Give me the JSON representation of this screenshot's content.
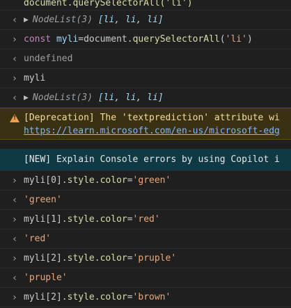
{
  "rows": [
    {
      "kind": "partial",
      "text": "document.querySelectorAll('li')"
    },
    {
      "kind": "nodelist",
      "prefix": "NodeList(3)",
      "items": "[li, li, li]"
    },
    {
      "kind": "input",
      "keyword": "const",
      "var": "myli",
      "rest1": "=document.",
      "fn": "querySelectorAll",
      "open": "(",
      "str": "'li'",
      "close": ")"
    },
    {
      "kind": "output",
      "text": "undefined"
    },
    {
      "kind": "input-plain",
      "text": "myli"
    },
    {
      "kind": "nodelist",
      "prefix": "NodeList(3)",
      "items": "[li, li, li]"
    }
  ],
  "warning": {
    "line1": "[Deprecation] The 'textprediction' attribute wi",
    "line2": "https://learn.microsoft.com/en-us/microsoft-edg"
  },
  "info": {
    "text": "[NEW] Explain Console errors by using Copilot i"
  },
  "commands": [
    {
      "obj": "myli[0].",
      "prop": "style.color",
      "eq": "=",
      "val": "'green'",
      "out": "'green'"
    },
    {
      "obj": "myli[1].",
      "prop": "style.color",
      "eq": "=",
      "val": "'red'",
      "out": "'red'"
    },
    {
      "obj": "myli[2].",
      "prop": "style.color",
      "eq": "=",
      "val": "'pruple'",
      "out": "'pruple'"
    },
    {
      "obj": "myli[2].",
      "prop": "style.color",
      "eq": "=",
      "val": "'brown'",
      "out": ""
    }
  ],
  "icons": {
    "input": "chevron-right-icon",
    "output": "return-arrow-icon",
    "expand": "triangle-right-icon",
    "warning": "warning-icon"
  },
  "colors": {
    "background": "#1f1f1f",
    "warning_bg": "#3a3112",
    "info_bg": "#0f3a45",
    "string": "#e8a87c",
    "keyword": "#c586c0"
  }
}
